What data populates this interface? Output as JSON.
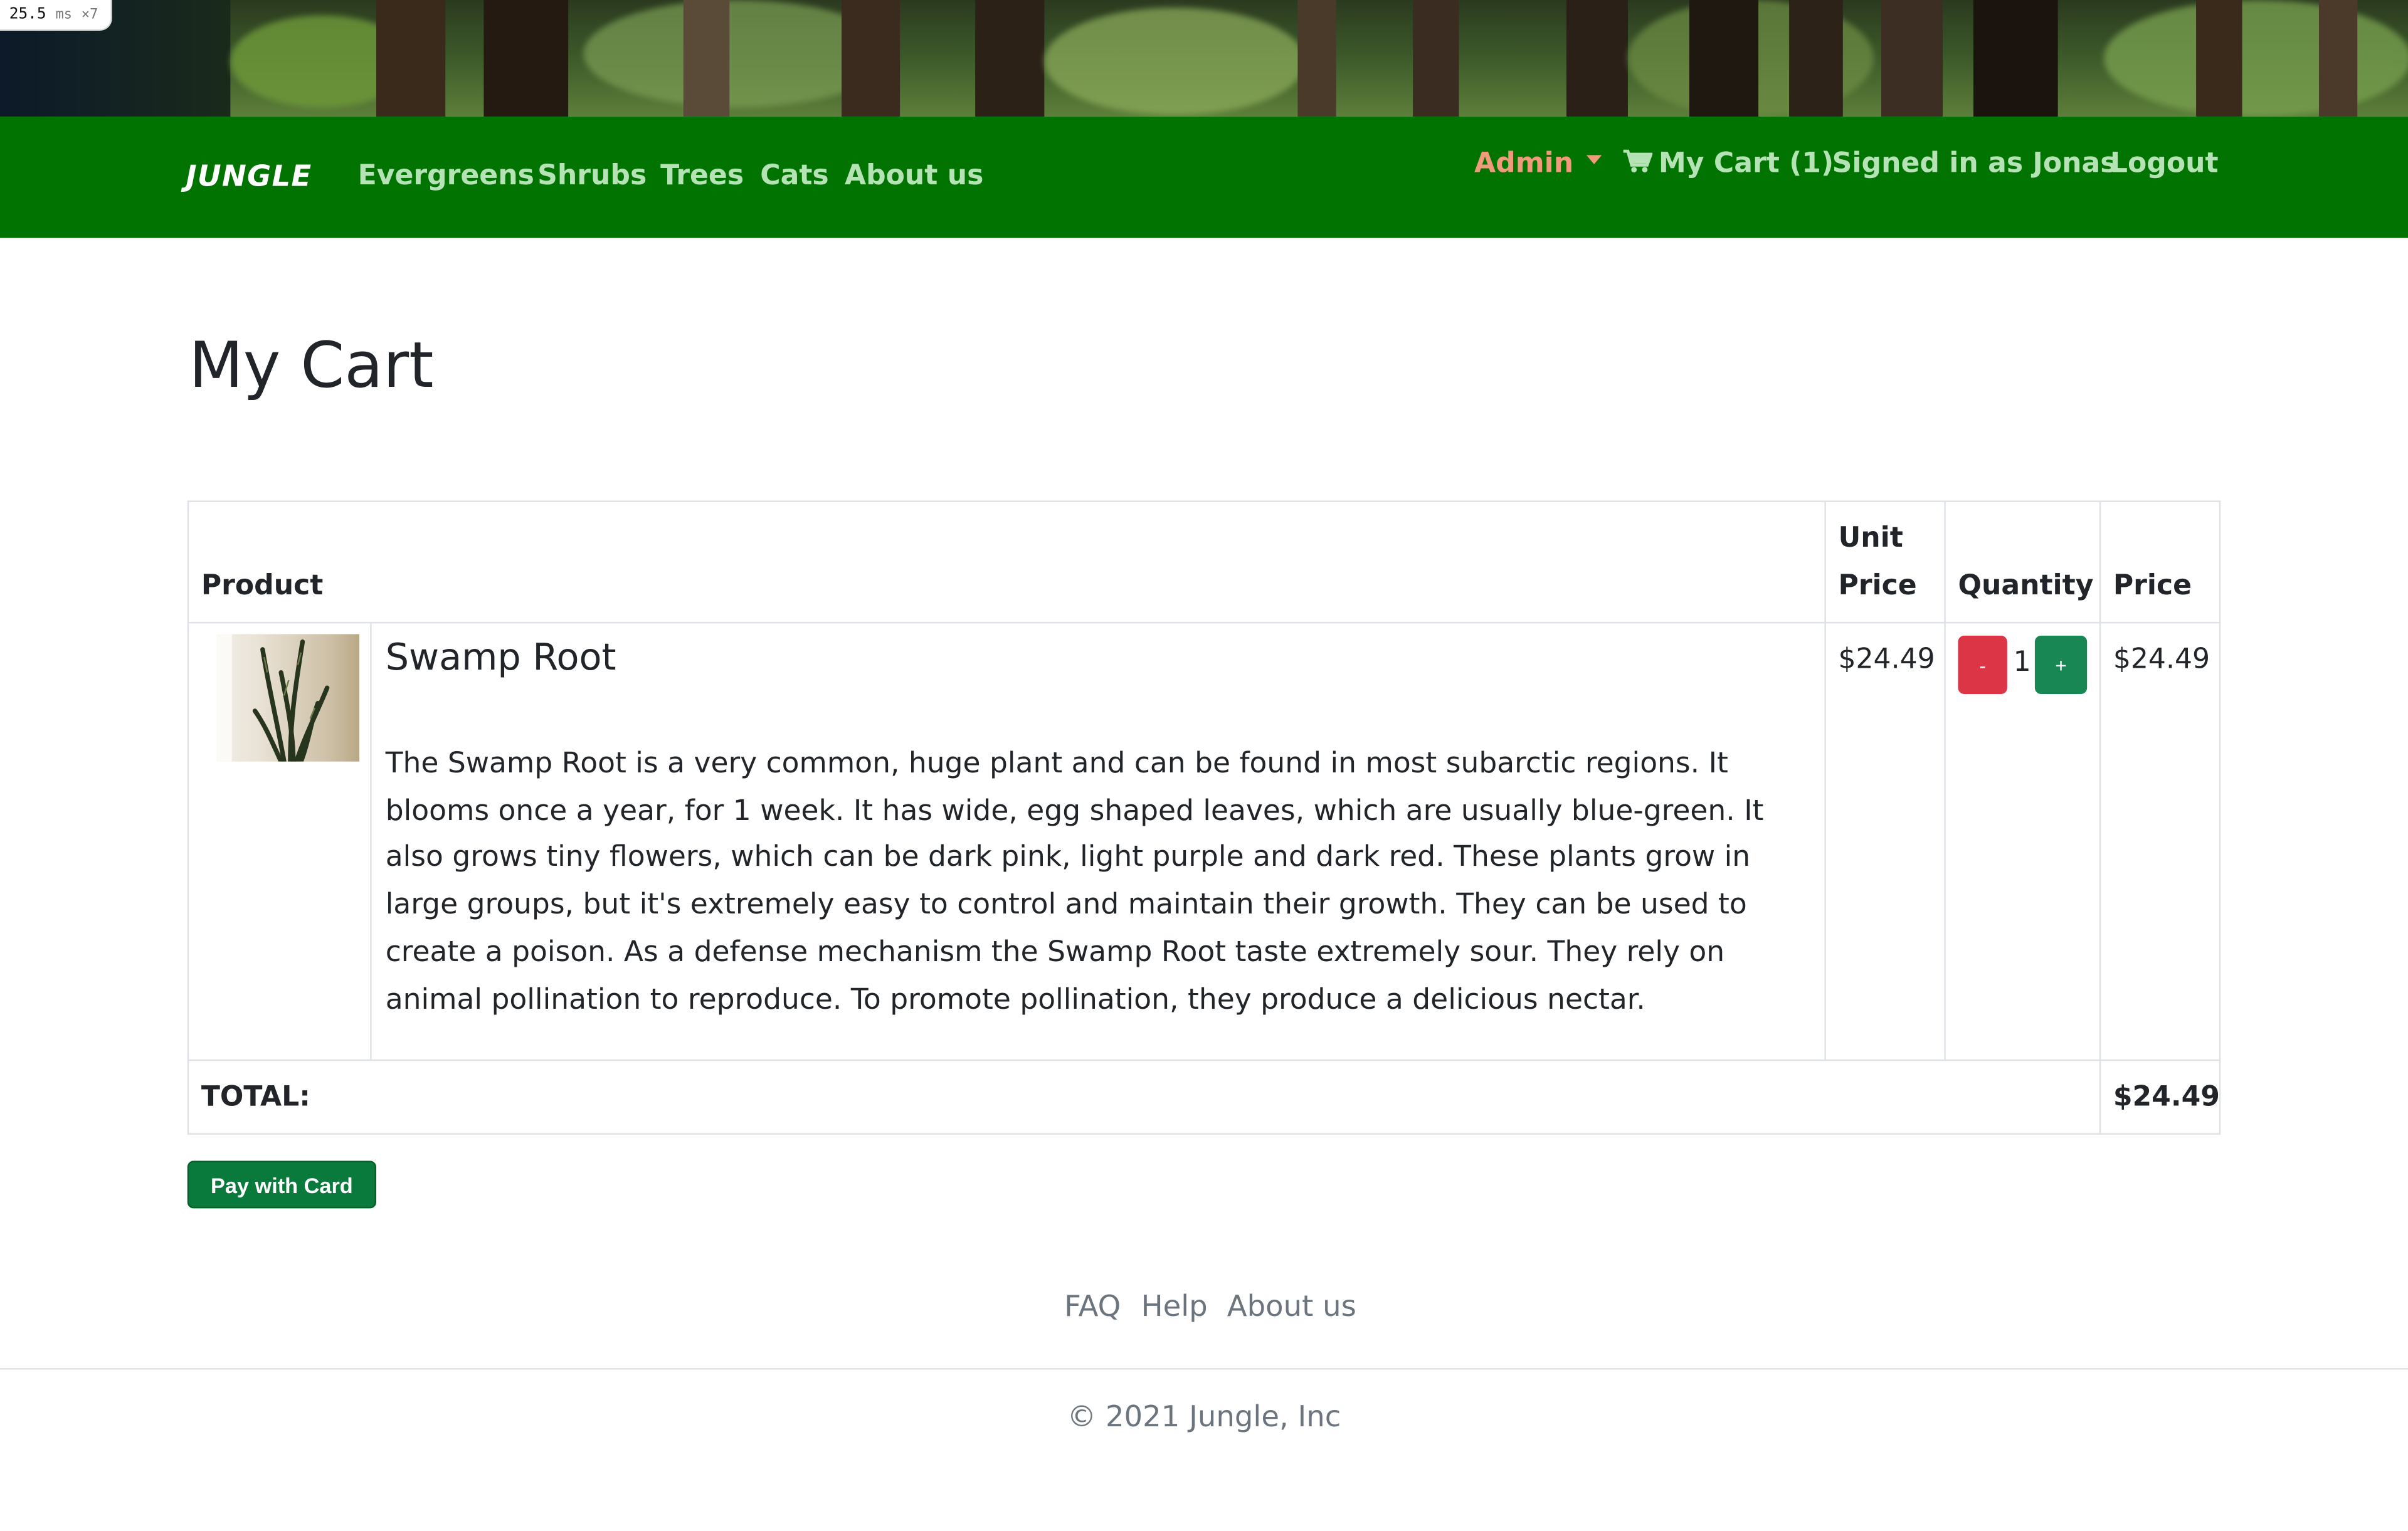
{
  "perf": {
    "value": "25.5",
    "unit": "ms",
    "mult": "×7"
  },
  "nav": {
    "brand": "JUNGLE",
    "links": [
      "Evergreens",
      "Shrubs",
      "Trees",
      "Cats",
      "About us"
    ],
    "admin": "Admin",
    "cart": "My Cart (1)",
    "signed_in": "Signed in as Jonas",
    "logout": "Logout"
  },
  "page": {
    "title": "My Cart"
  },
  "table": {
    "headers": {
      "product": "Product",
      "unit_price_1": "Unit",
      "unit_price_2": "Price",
      "quantity": "Quantity",
      "price": "Price"
    },
    "rows": [
      {
        "name": "Swamp Root",
        "description": "The Swamp Root is a very common, huge plant and can be found in most subarctic regions. It blooms once a year, for 1 week. It has wide, egg shaped leaves, which are usually blue-green. It also grows tiny flowers, which can be dark pink, light purple and dark red. These plants grow in large groups, but it's extremely easy to control and maintain their growth. They can be used to create a poison. As a defense mechanism the Swamp Root taste extremely sour. They rely on animal pollination to reproduce. To promote pollination, they produce a delicious nectar.",
        "unit_price": "$24.49",
        "minus": "-",
        "quantity": "1",
        "plus": "+",
        "price": "$24.49"
      }
    ],
    "total_label": "TOTAL:",
    "total_value": "$24.49"
  },
  "pay_button": "Pay with Card",
  "footer": {
    "links": [
      "FAQ",
      "Help",
      "About us"
    ],
    "copyright": "© 2021 Jungle, Inc"
  },
  "colors": {
    "navbar": "#007300",
    "navlink": "#b6e3b6",
    "admin": "#ef9a7a",
    "minus": "#dc3545",
    "plus": "#198754",
    "pay": "#0a7a3c"
  }
}
